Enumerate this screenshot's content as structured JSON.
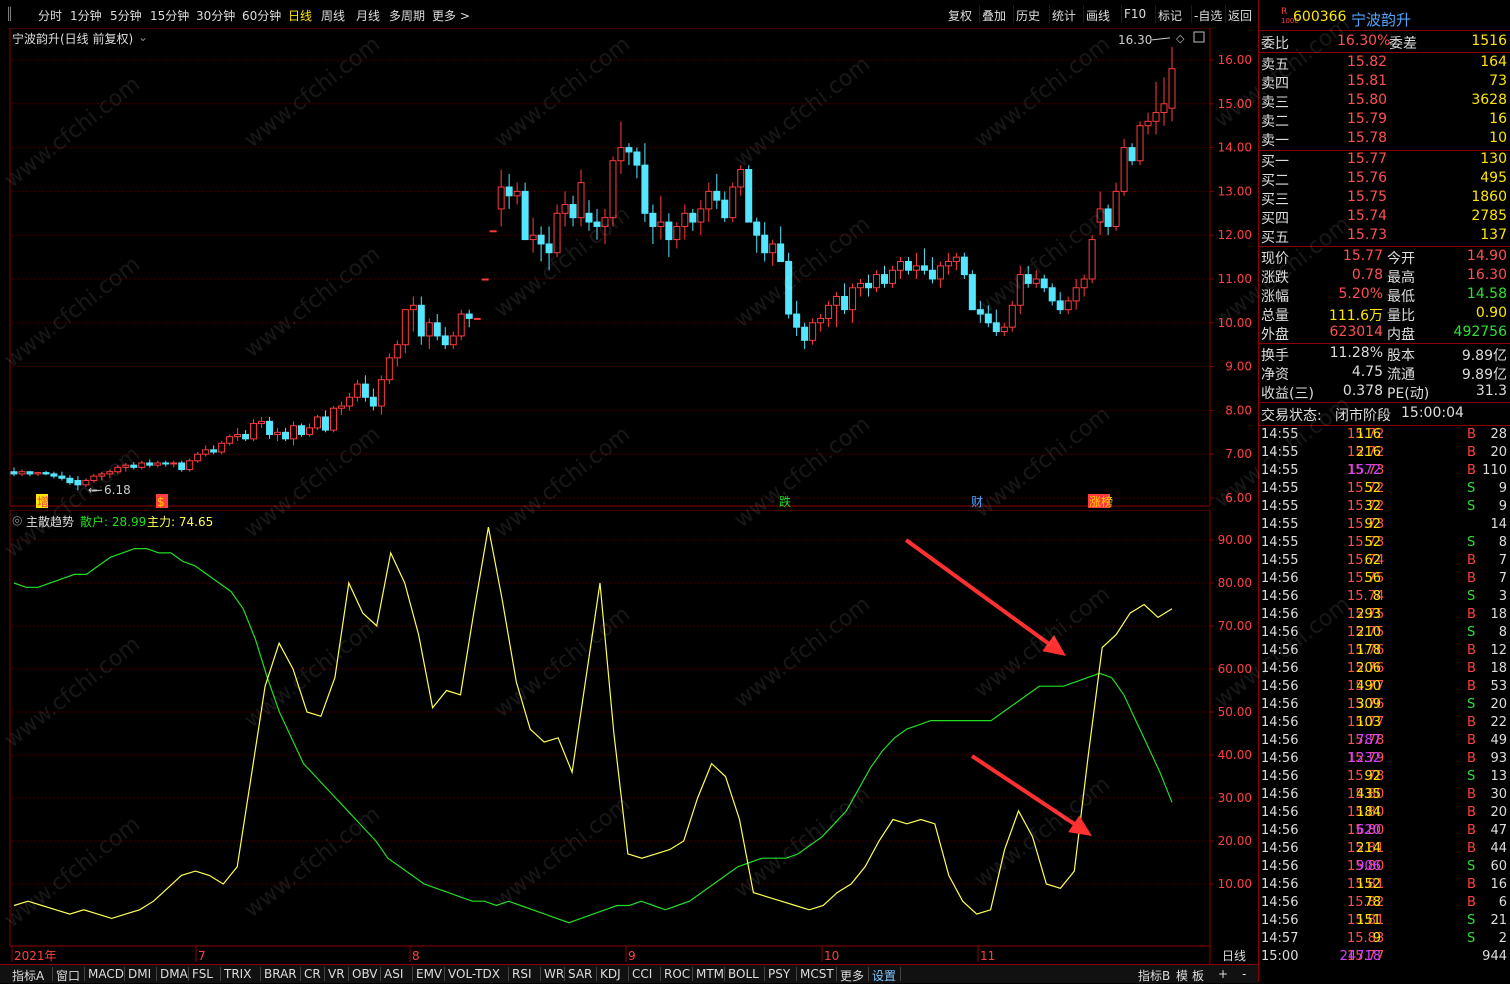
{
  "toolbar": {
    "periods": [
      "分时",
      "1分钟",
      "5分钟",
      "15分钟",
      "30分钟",
      "60分钟",
      "日线",
      "周线",
      "月线",
      "多周期",
      "更多 >"
    ],
    "active_period": "日线",
    "tools": [
      "复权",
      "叠加",
      "历史",
      "统计",
      "画线",
      "F10",
      "标记",
      "-自选",
      "返回"
    ]
  },
  "main_chart": {
    "title": "宁波韵升(日线 前复权)",
    "max_label": "16.30",
    "min_label": "6.18",
    "markers": [
      "增",
      "$",
      "跌",
      "财",
      "涨榜"
    ],
    "y_ticks": [
      "16.00",
      "15.00",
      "14.00",
      "13.00",
      "12.00",
      "11.00",
      "10.00",
      "9.00",
      "8.00",
      "7.00",
      "6.00"
    ]
  },
  "indicator": {
    "name": "主散趋势",
    "retail_label": "散户: 28.99",
    "main_label": "主力: 74.65",
    "y_ticks": [
      "90.00",
      "80.00",
      "70.00",
      "60.00",
      "50.00",
      "40.00",
      "30.00",
      "20.00",
      "10.00"
    ]
  },
  "x_axis": {
    "labels": [
      "2021年",
      "7",
      "8",
      "9",
      "10",
      "11"
    ],
    "period_label": "日线"
  },
  "bottom_tabs": [
    "指标A",
    "窗口",
    "MACD",
    "DMI",
    "DMA",
    "FSL",
    "TRIX",
    "BRAR",
    "CR",
    "VR",
    "OBV",
    "ASI",
    "EMV",
    "VOL-TDX",
    "RSI",
    "WR",
    "SAR",
    "KDJ",
    "CCI",
    "ROC",
    "MTM",
    "BOLL",
    "PSY",
    "MCST",
    "更多",
    "设置"
  ],
  "bottom_right": [
    "指标B",
    "模",
    "板",
    "+",
    "-"
  ],
  "stock": {
    "badge_top": "R",
    "badge_bottom": "1000",
    "code": "600366",
    "name": "宁波韵升"
  },
  "order_book": {
    "weibi_label": "委比",
    "weibi_value": "16.30%",
    "weicha_label": "委差",
    "weicha_value": "1516",
    "asks": [
      {
        "label": "卖五",
        "price": "15.82",
        "vol": "164"
      },
      {
        "label": "卖四",
        "price": "15.81",
        "vol": "73"
      },
      {
        "label": "卖三",
        "price": "15.80",
        "vol": "3628"
      },
      {
        "label": "卖二",
        "price": "15.79",
        "vol": "16"
      },
      {
        "label": "卖一",
        "price": "15.78",
        "vol": "10"
      }
    ],
    "bids": [
      {
        "label": "买一",
        "price": "15.77",
        "vol": "130"
      },
      {
        "label": "买二",
        "price": "15.76",
        "vol": "495"
      },
      {
        "label": "买三",
        "price": "15.75",
        "vol": "1860"
      },
      {
        "label": "买四",
        "price": "15.74",
        "vol": "2785"
      },
      {
        "label": "买五",
        "price": "15.73",
        "vol": "137"
      }
    ]
  },
  "quote": [
    {
      "l1": "现价",
      "v1": "15.77",
      "l2": "今开",
      "v2": "14.90",
      "c1": "#ff5050",
      "c2": "#ff5050"
    },
    {
      "l1": "涨跌",
      "v1": "0.78",
      "l2": "最高",
      "v2": "16.30",
      "c1": "#ff5050",
      "c2": "#ff5050"
    },
    {
      "l1": "涨幅",
      "v1": "5.20%",
      "l2": "最低",
      "v2": "14.58",
      "c1": "#ff5050",
      "c2": "#30e030"
    },
    {
      "l1": "总量",
      "v1": "111.6万",
      "l2": "量比",
      "v2": "0.90",
      "c1": "#ffe600",
      "c2": "#ffe600"
    },
    {
      "l1": "外盘",
      "v1": "623014",
      "l2": "内盘",
      "v2": "492756",
      "c1": "#ff5050",
      "c2": "#30e030"
    },
    {
      "l1": "换手",
      "v1": "11.28%",
      "l2": "股本",
      "v2": "9.89亿",
      "c1": "#dddddd",
      "c2": "#dddddd"
    },
    {
      "l1": "净资",
      "v1": "4.75",
      "l2": "流通",
      "v2": "9.89亿",
      "c1": "#dddddd",
      "c2": "#dddddd"
    },
    {
      "l1": "收益(三)",
      "v1": "0.378",
      "l2": "PE(动)",
      "v2": "31.3",
      "c1": "#dddddd",
      "c2": "#dddddd"
    }
  ],
  "trade_status": {
    "label": "交易状态:",
    "value": "闭市阶段",
    "time": "15:00:04"
  },
  "ticks": [
    [
      "14:55",
      "15.72",
      "116",
      "B",
      "28"
    ],
    [
      "14:55",
      "15.72",
      "216",
      "B",
      "20"
    ],
    [
      "14:55",
      "15.73",
      "1572",
      "B",
      "110"
    ],
    [
      "14:55",
      "15.72",
      "52",
      "S",
      "9"
    ],
    [
      "14:55",
      "15.72",
      "32",
      "S",
      "9"
    ],
    [
      "14:55",
      "15.73",
      "92",
      "",
      "14"
    ],
    [
      "14:55",
      "15.73",
      "52",
      "S",
      "8"
    ],
    [
      "14:55",
      "15.74",
      "62",
      "B",
      "7"
    ],
    [
      "14:56",
      "15.75",
      "56",
      "B",
      "7"
    ],
    [
      "14:56",
      "15.74",
      "8",
      "S",
      "3"
    ],
    [
      "14:56",
      "15.75",
      "293",
      "B",
      "18"
    ],
    [
      "14:56",
      "15.75",
      "210",
      "S",
      "8"
    ],
    [
      "14:56",
      "15.76",
      "178",
      "B",
      "12"
    ],
    [
      "14:56",
      "15.76",
      "206",
      "B",
      "18"
    ],
    [
      "14:56",
      "15.77",
      "490",
      "B",
      "53"
    ],
    [
      "14:56",
      "15.76",
      "309",
      "S",
      "20"
    ],
    [
      "14:56",
      "15.77",
      "103",
      "B",
      "22"
    ],
    [
      "14:56",
      "15.78",
      "787",
      "B",
      "49"
    ],
    [
      "14:56",
      "15.79",
      "1232",
      "B",
      "93"
    ],
    [
      "14:56",
      "15.78",
      "92",
      "S",
      "13"
    ],
    [
      "14:56",
      "15.80",
      "435",
      "B",
      "30"
    ],
    [
      "14:56",
      "15.80",
      "184",
      "B",
      "20"
    ],
    [
      "14:56",
      "15.80",
      "620",
      "B",
      "47"
    ],
    [
      "14:56",
      "15.81",
      "214",
      "B",
      "44"
    ],
    [
      "14:56",
      "15.80",
      "906",
      "S",
      "60"
    ],
    [
      "14:56",
      "15.81",
      "152",
      "B",
      "16"
    ],
    [
      "14:56",
      "15.82",
      "78",
      "B",
      "6"
    ],
    [
      "14:56",
      "15.81",
      "151",
      "S",
      "21"
    ],
    [
      "14:57",
      "15.83",
      "9",
      "S",
      "2"
    ],
    [
      "15:00",
      "15.77",
      "24718",
      "",
      "944"
    ]
  ],
  "watermark": "www.cfchi.com",
  "colors": {
    "up": "#ff3b3b",
    "down": "#54e6ff",
    "retail": "#22dd22",
    "main": "#ffff55",
    "grid": "#5a0000",
    "border": "#8b0000"
  },
  "chart_data": {
    "type": "candlestick",
    "candles": [
      [
        6.6,
        6.7,
        6.5,
        6.55
      ],
      [
        6.55,
        6.65,
        6.5,
        6.6
      ],
      [
        6.6,
        6.62,
        6.5,
        6.55
      ],
      [
        6.55,
        6.6,
        6.5,
        6.58
      ],
      [
        6.58,
        6.62,
        6.52,
        6.55
      ],
      [
        6.55,
        6.6,
        6.45,
        6.5
      ],
      [
        6.5,
        6.6,
        6.4,
        6.45
      ],
      [
        6.45,
        6.52,
        6.3,
        6.35
      ],
      [
        6.4,
        6.5,
        6.18,
        6.3
      ],
      [
        6.3,
        6.45,
        6.25,
        6.4
      ],
      [
        6.4,
        6.55,
        6.35,
        6.5
      ],
      [
        6.5,
        6.6,
        6.4,
        6.55
      ],
      [
        6.55,
        6.65,
        6.45,
        6.6
      ],
      [
        6.6,
        6.75,
        6.55,
        6.7
      ],
      [
        6.7,
        6.8,
        6.6,
        6.75
      ],
      [
        6.75,
        6.82,
        6.65,
        6.7
      ],
      [
        6.7,
        6.85,
        6.65,
        6.8
      ],
      [
        6.8,
        6.88,
        6.7,
        6.75
      ],
      [
        6.75,
        6.85,
        6.7,
        6.8
      ],
      [
        6.8,
        6.85,
        6.72,
        6.78
      ],
      [
        6.78,
        6.85,
        6.7,
        6.8
      ],
      [
        6.8,
        6.85,
        6.6,
        6.65
      ],
      [
        6.65,
        6.9,
        6.6,
        6.85
      ],
      [
        6.85,
        7.05,
        6.8,
        7.0
      ],
      [
        7.0,
        7.2,
        6.95,
        7.1
      ],
      [
        7.1,
        7.2,
        7.0,
        7.05
      ],
      [
        7.05,
        7.3,
        7.0,
        7.25
      ],
      [
        7.25,
        7.45,
        7.2,
        7.4
      ],
      [
        7.4,
        7.6,
        7.3,
        7.45
      ],
      [
        7.45,
        7.55,
        7.3,
        7.35
      ],
      [
        7.35,
        7.8,
        7.3,
        7.7
      ],
      [
        7.7,
        7.85,
        7.6,
        7.75
      ],
      [
        7.75,
        7.85,
        7.35,
        7.45
      ],
      [
        7.45,
        7.6,
        7.3,
        7.5
      ],
      [
        7.5,
        7.6,
        7.3,
        7.35
      ],
      [
        7.35,
        7.75,
        7.2,
        7.65
      ],
      [
        7.65,
        7.7,
        7.4,
        7.45
      ],
      [
        7.45,
        7.7,
        7.4,
        7.6
      ],
      [
        7.6,
        7.9,
        7.55,
        7.85
      ],
      [
        7.85,
        8.0,
        7.5,
        7.55
      ],
      [
        7.55,
        8.1,
        7.5,
        8.05
      ],
      [
        8.05,
        8.2,
        7.9,
        8.1
      ],
      [
        8.1,
        8.4,
        8.0,
        8.3
      ],
      [
        8.3,
        8.7,
        8.2,
        8.6
      ],
      [
        8.6,
        8.8,
        8.2,
        8.3
      ],
      [
        8.3,
        8.5,
        8.0,
        8.1
      ],
      [
        8.1,
        8.8,
        7.9,
        8.7
      ],
      [
        8.7,
        9.3,
        8.6,
        9.2
      ],
      [
        9.2,
        9.6,
        9.0,
        9.5
      ],
      [
        9.5,
        10.3,
        9.3,
        10.3
      ],
      [
        10.3,
        10.6,
        9.8,
        10.4
      ],
      [
        10.4,
        10.6,
        9.5,
        9.7
      ],
      [
        9.7,
        10.1,
        9.4,
        10.0
      ],
      [
        10.0,
        10.2,
        9.6,
        9.7
      ],
      [
        9.7,
        9.9,
        9.4,
        9.5
      ],
      [
        9.5,
        9.8,
        9.4,
        9.7
      ],
      [
        9.7,
        10.3,
        9.6,
        10.2
      ],
      [
        10.2,
        10.3,
        9.9,
        10.1
      ],
      [
        10.1,
        10.1,
        10.1,
        10.1
      ],
      [
        11.0,
        11.0,
        11.0,
        11.0
      ],
      [
        12.1,
        12.1,
        12.1,
        12.1
      ],
      [
        12.6,
        13.5,
        12.2,
        13.1
      ],
      [
        13.1,
        13.4,
        12.6,
        12.9
      ],
      [
        12.9,
        13.2,
        12.7,
        13.0
      ],
      [
        13.0,
        13.2,
        11.9,
        11.9
      ],
      [
        11.9,
        12.4,
        11.6,
        12.0
      ],
      [
        12.0,
        12.2,
        11.4,
        11.8
      ],
      [
        11.8,
        12.2,
        11.2,
        11.6
      ],
      [
        11.6,
        12.7,
        11.5,
        12.5
      ],
      [
        12.5,
        13.0,
        12.2,
        12.7
      ],
      [
        12.7,
        12.9,
        12.2,
        12.4
      ],
      [
        12.4,
        13.5,
        12.2,
        13.2
      ],
      [
        12.5,
        12.8,
        12.1,
        12.3
      ],
      [
        12.3,
        12.6,
        11.9,
        12.2
      ],
      [
        12.2,
        12.6,
        11.8,
        12.4
      ],
      [
        12.4,
        13.8,
        12.2,
        13.7
      ],
      [
        13.7,
        14.6,
        13.4,
        14.0
      ],
      [
        14.0,
        14.1,
        13.6,
        13.9
      ],
      [
        13.9,
        14.0,
        13.3,
        13.6
      ],
      [
        13.6,
        14.1,
        12.3,
        12.5
      ],
      [
        12.5,
        12.7,
        11.8,
        12.2
      ],
      [
        12.2,
        12.9,
        11.9,
        12.3
      ],
      [
        12.3,
        12.5,
        11.5,
        11.9
      ],
      [
        11.9,
        12.3,
        11.7,
        12.2
      ],
      [
        12.2,
        12.7,
        11.9,
        12.5
      ],
      [
        12.5,
        12.6,
        12.1,
        12.3
      ],
      [
        12.3,
        12.8,
        12.0,
        12.6
      ],
      [
        12.6,
        13.2,
        12.3,
        13.0
      ],
      [
        13.0,
        13.4,
        12.6,
        12.8
      ],
      [
        12.8,
        13.0,
        12.3,
        12.4
      ],
      [
        12.4,
        13.2,
        12.3,
        13.1
      ],
      [
        13.1,
        13.6,
        12.9,
        13.5
      ],
      [
        13.5,
        13.6,
        12.5,
        12.3
      ],
      [
        12.3,
        12.4,
        11.6,
        12.0
      ],
      [
        12.0,
        12.3,
        11.4,
        11.6
      ],
      [
        11.6,
        11.9,
        11.3,
        11.8
      ],
      [
        11.8,
        12.2,
        11.4,
        11.4
      ],
      [
        11.4,
        11.6,
        10.1,
        10.2
      ],
      [
        10.2,
        10.5,
        9.7,
        9.9
      ],
      [
        9.9,
        10.0,
        9.4,
        9.6
      ],
      [
        9.6,
        10.1,
        9.5,
        10.0
      ],
      [
        10.0,
        10.2,
        9.8,
        10.1
      ],
      [
        10.1,
        10.5,
        9.9,
        10.4
      ],
      [
        10.4,
        10.7,
        9.9,
        10.6
      ],
      [
        10.6,
        10.9,
        10.2,
        10.3
      ],
      [
        10.3,
        10.9,
        10.0,
        10.8
      ],
      [
        10.8,
        11.0,
        10.6,
        10.9
      ],
      [
        10.9,
        11.1,
        10.6,
        10.8
      ],
      [
        10.8,
        11.2,
        10.7,
        11.1
      ],
      [
        11.1,
        11.3,
        10.8,
        10.9
      ],
      [
        10.9,
        11.3,
        10.8,
        11.2
      ],
      [
        11.2,
        11.5,
        11.0,
        11.4
      ],
      [
        11.4,
        11.5,
        11.1,
        11.2
      ],
      [
        11.2,
        11.6,
        11.0,
        11.3
      ],
      [
        11.3,
        11.7,
        11.1,
        11.2
      ],
      [
        11.2,
        11.5,
        10.9,
        11.0
      ],
      [
        11.0,
        11.4,
        10.8,
        11.3
      ],
      [
        11.3,
        11.6,
        11.1,
        11.4
      ],
      [
        11.4,
        11.6,
        11.2,
        11.5
      ],
      [
        11.5,
        11.6,
        11.0,
        11.1
      ],
      [
        11.1,
        11.2,
        10.3,
        10.3
      ],
      [
        10.3,
        10.5,
        10.0,
        10.2
      ],
      [
        10.2,
        10.4,
        9.9,
        10.0
      ],
      [
        10.0,
        10.3,
        9.7,
        9.8
      ],
      [
        9.8,
        10.0,
        9.7,
        9.9
      ],
      [
        9.9,
        10.5,
        9.8,
        10.4
      ],
      [
        10.4,
        11.3,
        10.2,
        11.1
      ],
      [
        11.1,
        11.3,
        10.8,
        10.9
      ],
      [
        10.9,
        11.2,
        10.8,
        11.0
      ],
      [
        11.0,
        11.1,
        10.7,
        10.8
      ],
      [
        10.8,
        10.9,
        10.4,
        10.5
      ],
      [
        10.5,
        10.7,
        10.2,
        10.3
      ],
      [
        10.3,
        10.6,
        10.2,
        10.5
      ],
      [
        10.5,
        11.0,
        10.3,
        10.8
      ],
      [
        10.8,
        11.1,
        10.6,
        11.0
      ],
      [
        11.0,
        12.0,
        10.9,
        11.9
      ],
      [
        12.3,
        13.0,
        12.0,
        12.6
      ],
      [
        12.6,
        12.7,
        12.0,
        12.2
      ],
      [
        12.2,
        13.2,
        12.1,
        13.0
      ],
      [
        13.0,
        14.2,
        12.9,
        14.0
      ],
      [
        14.0,
        14.1,
        13.6,
        13.7
      ],
      [
        13.7,
        14.6,
        13.6,
        14.5
      ],
      [
        14.5,
        14.8,
        14.3,
        14.6
      ],
      [
        14.6,
        15.5,
        14.3,
        14.8
      ],
      [
        14.8,
        15.6,
        14.5,
        15.0
      ],
      [
        14.9,
        16.3,
        14.6,
        15.8
      ]
    ],
    "retail_series": [
      80,
      79,
      79,
      80,
      81,
      82,
      82,
      84,
      86,
      87,
      88,
      88,
      87,
      87,
      85,
      84,
      82,
      80,
      78,
      74,
      67,
      58,
      50,
      44,
      38,
      35,
      32,
      29,
      26,
      23,
      20,
      16,
      14,
      12,
      10,
      9,
      8,
      7,
      6,
      6,
      5,
      6,
      5,
      4,
      3,
      2,
      1,
      2,
      3,
      4,
      5,
      5,
      6,
      5,
      4,
      5,
      6,
      8,
      10,
      12,
      14,
      15,
      16,
      16,
      16,
      17,
      19,
      21,
      24,
      27,
      32,
      37,
      41,
      44,
      46,
      47,
      48,
      48,
      48,
      48,
      48,
      48,
      50,
      52,
      54,
      56,
      56,
      56,
      57,
      58,
      59,
      58,
      54,
      48,
      42,
      36,
      29
    ],
    "main_series": [
      5,
      6,
      5,
      4,
      3,
      4,
      3,
      2,
      3,
      4,
      6,
      9,
      12,
      13,
      12,
      10,
      14,
      35,
      56,
      66,
      60,
      50,
      49,
      58,
      80,
      73,
      70,
      87,
      80,
      68,
      51,
      55,
      54,
      74,
      93,
      76,
      57,
      46,
      43,
      44,
      36,
      58,
      80,
      45,
      17,
      16,
      17,
      18,
      20,
      30,
      38,
      35,
      25,
      8,
      7,
      6,
      5,
      4,
      5,
      8,
      10,
      14,
      20,
      25,
      24,
      25,
      24,
      12,
      6,
      3,
      4,
      18,
      27,
      21,
      10,
      9,
      13,
      40,
      65,
      68,
      73,
      75,
      72,
      74
    ]
  }
}
